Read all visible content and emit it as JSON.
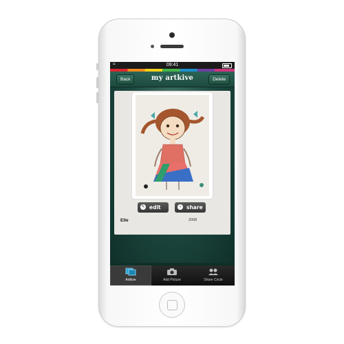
{
  "status_bar": {
    "time": "09:41",
    "wifi_icon": "wifi-icon",
    "battery_icon": "battery-icon"
  },
  "nav": {
    "title": "my artkive",
    "back_label": "Back",
    "delete_label": "Delete"
  },
  "artwork": {
    "actions": {
      "edit_label": "edit",
      "share_label": "share",
      "edit_icon": "pencil-icon",
      "share_icon": "arrow-right-icon"
    },
    "child_name": "Elle",
    "year": "2008"
  },
  "tabs": [
    {
      "label": "Artkive",
      "icon": "gallery-icon",
      "active": true
    },
    {
      "label": "Add Picture",
      "icon": "camera-icon",
      "active": false
    },
    {
      "label": "Share Circle",
      "icon": "people-icon",
      "active": false
    }
  ],
  "colors": {
    "nav_green": "#1d4a3f",
    "background_green": "#10302a",
    "tab_active": "#3a3a3a",
    "rainbow": [
      "#d9272e",
      "#f08a1c",
      "#f3d11a",
      "#44b649",
      "#1d8fd1",
      "#6f3fa0",
      "#d0347f"
    ]
  }
}
